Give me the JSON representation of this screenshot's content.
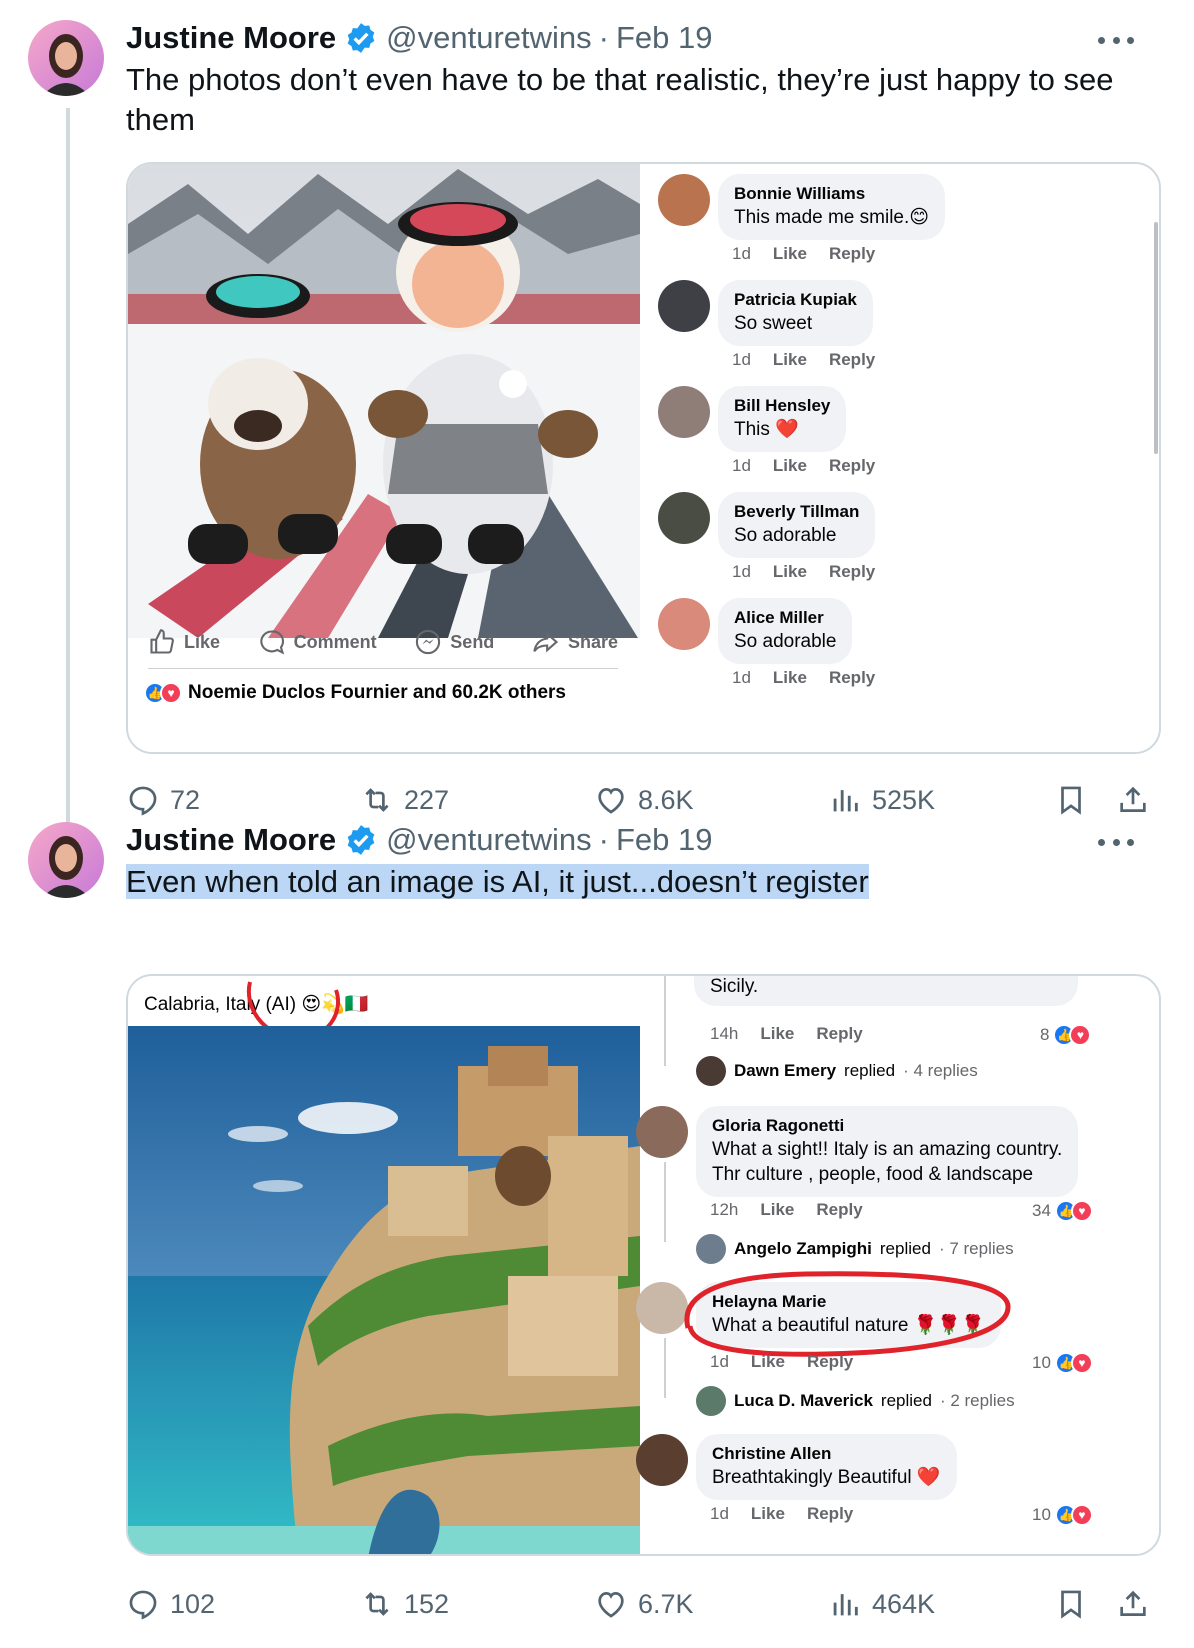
{
  "tweets": [
    {
      "author_name": "Justine Moore",
      "handle": "@venturetwins",
      "separator": "·",
      "date": "Feb 19",
      "text": "The photos don’t even have to be that realistic, they’re just happy to see them",
      "fb_post": {
        "actions": [
          "Like",
          "Comment",
          "Send",
          "Share"
        ],
        "reactions_text": "Noemie Duclos Fournier and 60.2K others",
        "comments": [
          {
            "name": "Bonnie Williams",
            "text": "This made me smile.",
            "emoji": "😊",
            "time": "1d",
            "like": "Like",
            "reply": "Reply"
          },
          {
            "name": "Patricia Kupiak",
            "text": "So sweet",
            "emoji": "",
            "time": "1d",
            "like": "Like",
            "reply": "Reply"
          },
          {
            "name": "Bill Hensley",
            "text": "This",
            "emoji": "❤️",
            "time": "1d",
            "like": "Like",
            "reply": "Reply"
          },
          {
            "name": "Beverly Tillman",
            "text": "So adorable",
            "emoji": "",
            "time": "1d",
            "like": "Like",
            "reply": "Reply"
          },
          {
            "name": "Alice Miller",
            "text": "So adorable",
            "emoji": "",
            "time": "1d",
            "like": "Like",
            "reply": "Reply"
          }
        ]
      },
      "stats": {
        "replies": "72",
        "retweets": "227",
        "likes": "8.6K",
        "views": "525K"
      }
    },
    {
      "author_name": "Justine Moore",
      "handle": "@venturetwins",
      "separator": "·",
      "date": "Feb 19",
      "text": "Even when told an image is AI, it just...doesn’t register",
      "fb_post": {
        "caption": "Calabria, Italy (AI)",
        "caption_emojis": "😍💫🇮🇹",
        "partial_comment": {
          "text": "Sicily.",
          "time": "14h",
          "like": "Like",
          "reply": "Reply",
          "count": "8"
        },
        "replied_rows": [
          {
            "name": "Dawn Emery",
            "verb": "replied",
            "count": "· 4 replies"
          },
          {
            "name": "Angelo Zampighi",
            "verb": "replied",
            "count": "· 7 replies"
          },
          {
            "name": "Luca D. Maverick",
            "verb": "replied",
            "count": "· 2 replies"
          }
        ],
        "comments": [
          {
            "name": "Gloria Ragonetti",
            "line1": "What a sight!! Italy is an amazing country.",
            "line2": "Thr culture , people, food & landscape",
            "time": "12h",
            "like": "Like",
            "reply": "Reply",
            "count": "34"
          },
          {
            "name": "Helayna Marie",
            "line1": "What a beautiful nature",
            "emoji": "🌹🌹🌹",
            "time": "1d",
            "like": "Like",
            "reply": "Reply",
            "count": "10"
          },
          {
            "name": "Christine Allen",
            "line1": "Breathtakingly Beautiful",
            "emoji": "❤️",
            "time": "1d",
            "like": "Like",
            "reply": "Reply",
            "count": "10"
          }
        ]
      },
      "stats": {
        "replies": "102",
        "retweets": "152",
        "likes": "6.7K",
        "views": "464K"
      }
    }
  ],
  "icons": {
    "verified": "verified-badge-icon",
    "reply": "reply-icon",
    "retweet": "retweet-icon",
    "like": "heart-icon",
    "views": "views-icon",
    "bookmark": "bookmark-icon",
    "share": "share-icon"
  },
  "colors": {
    "verified_blue": "#1d9bf0",
    "text_muted": "#536471",
    "fb_blue": "#1877f2",
    "highlight": "#bcd7f5",
    "annotation_red": "#e0222a"
  }
}
